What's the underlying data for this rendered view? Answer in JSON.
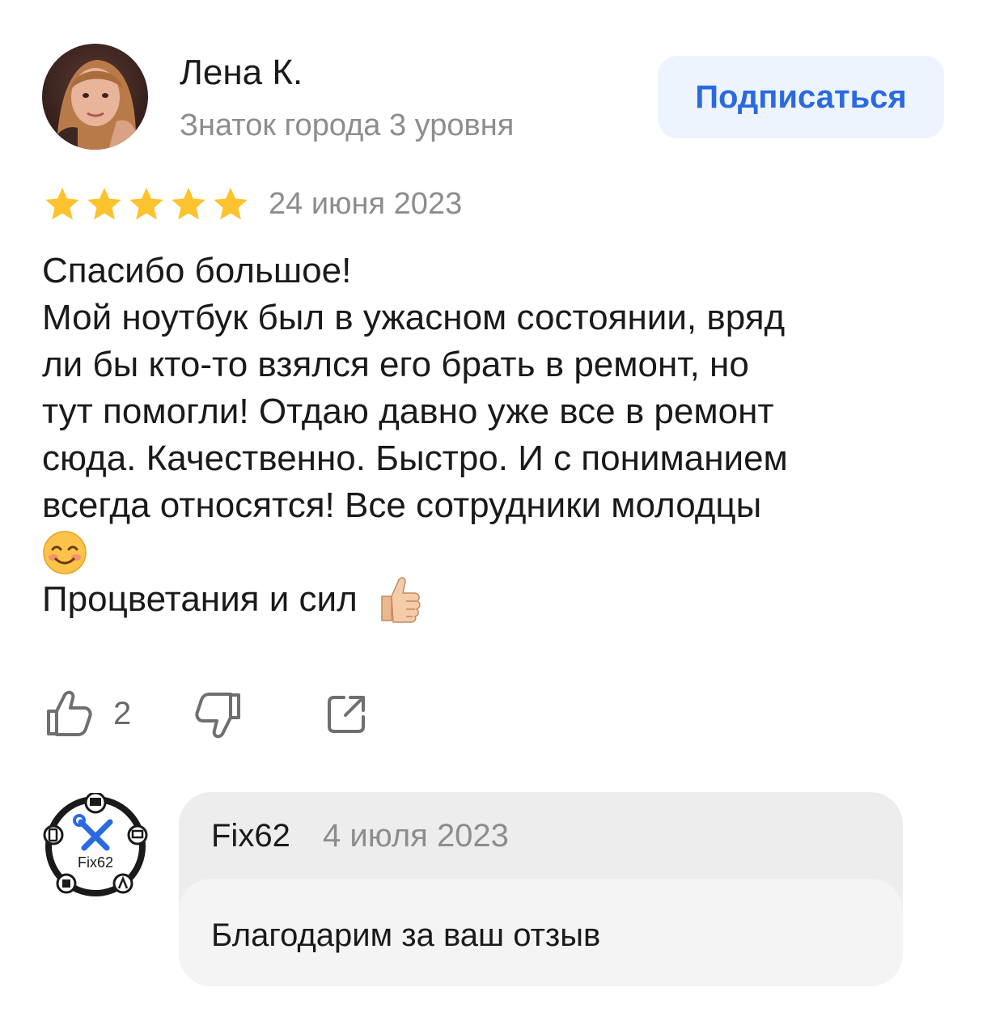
{
  "author": {
    "name": "Лена К.",
    "level": "Знаток города 3 уровня",
    "subscribe_label": "Подписаться"
  },
  "review": {
    "rating": 5,
    "rating_max": 5,
    "date": "24 июня 2023",
    "lines": [
      "Спасибо большое!",
      "Мой ноутбук был в ужасном состоянии, вряд",
      "ли бы кто-то взялся его брать в ремонт, но",
      "тут помогли! Отдаю давно уже все в ремонт",
      "сюда. Качественно. Быстро. И с пониманием",
      "всегда относятся! Все сотрудники молодцы",
      "☺️",
      "Процветания и сил"
    ],
    "closing_emoji": "👍🏼"
  },
  "actions": {
    "like_count": "2",
    "like_icon": "thumbs-up-icon",
    "dislike_icon": "thumbs-down-icon",
    "share_icon": "share-icon"
  },
  "reply": {
    "author": "Fix62",
    "date": "4 июля 2023",
    "text": "Благодарим за ваш отзыв",
    "logo_text": "Fix62"
  },
  "colors": {
    "accent": "#2a6ae0",
    "subscribe_bg": "#eef4fe",
    "star": "#fdc32e",
    "muted_text": "#8d8d8d",
    "reply_bg": "#ededed",
    "reply_body_bg": "#f4f4f4"
  }
}
